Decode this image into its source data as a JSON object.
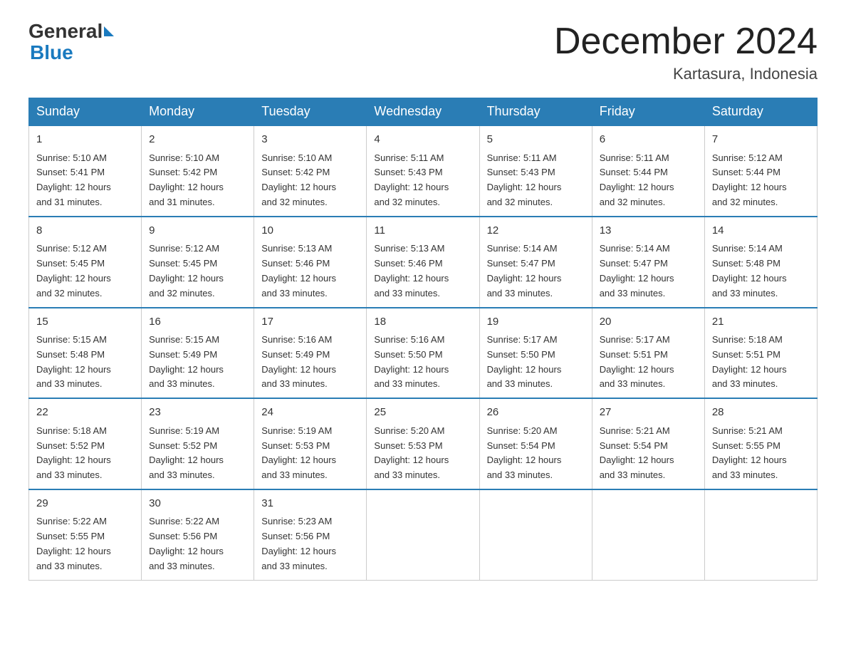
{
  "header": {
    "logo_general": "General",
    "logo_blue": "Blue",
    "title": "December 2024",
    "location": "Kartasura, Indonesia"
  },
  "days_of_week": [
    "Sunday",
    "Monday",
    "Tuesday",
    "Wednesday",
    "Thursday",
    "Friday",
    "Saturday"
  ],
  "weeks": [
    [
      {
        "day": "1",
        "sunrise": "5:10 AM",
        "sunset": "5:41 PM",
        "daylight": "12 hours and 31 minutes."
      },
      {
        "day": "2",
        "sunrise": "5:10 AM",
        "sunset": "5:42 PM",
        "daylight": "12 hours and 31 minutes."
      },
      {
        "day": "3",
        "sunrise": "5:10 AM",
        "sunset": "5:42 PM",
        "daylight": "12 hours and 32 minutes."
      },
      {
        "day": "4",
        "sunrise": "5:11 AM",
        "sunset": "5:43 PM",
        "daylight": "12 hours and 32 minutes."
      },
      {
        "day": "5",
        "sunrise": "5:11 AM",
        "sunset": "5:43 PM",
        "daylight": "12 hours and 32 minutes."
      },
      {
        "day": "6",
        "sunrise": "5:11 AM",
        "sunset": "5:44 PM",
        "daylight": "12 hours and 32 minutes."
      },
      {
        "day": "7",
        "sunrise": "5:12 AM",
        "sunset": "5:44 PM",
        "daylight": "12 hours and 32 minutes."
      }
    ],
    [
      {
        "day": "8",
        "sunrise": "5:12 AM",
        "sunset": "5:45 PM",
        "daylight": "12 hours and 32 minutes."
      },
      {
        "day": "9",
        "sunrise": "5:12 AM",
        "sunset": "5:45 PM",
        "daylight": "12 hours and 32 minutes."
      },
      {
        "day": "10",
        "sunrise": "5:13 AM",
        "sunset": "5:46 PM",
        "daylight": "12 hours and 33 minutes."
      },
      {
        "day": "11",
        "sunrise": "5:13 AM",
        "sunset": "5:46 PM",
        "daylight": "12 hours and 33 minutes."
      },
      {
        "day": "12",
        "sunrise": "5:14 AM",
        "sunset": "5:47 PM",
        "daylight": "12 hours and 33 minutes."
      },
      {
        "day": "13",
        "sunrise": "5:14 AM",
        "sunset": "5:47 PM",
        "daylight": "12 hours and 33 minutes."
      },
      {
        "day": "14",
        "sunrise": "5:14 AM",
        "sunset": "5:48 PM",
        "daylight": "12 hours and 33 minutes."
      }
    ],
    [
      {
        "day": "15",
        "sunrise": "5:15 AM",
        "sunset": "5:48 PM",
        "daylight": "12 hours and 33 minutes."
      },
      {
        "day": "16",
        "sunrise": "5:15 AM",
        "sunset": "5:49 PM",
        "daylight": "12 hours and 33 minutes."
      },
      {
        "day": "17",
        "sunrise": "5:16 AM",
        "sunset": "5:49 PM",
        "daylight": "12 hours and 33 minutes."
      },
      {
        "day": "18",
        "sunrise": "5:16 AM",
        "sunset": "5:50 PM",
        "daylight": "12 hours and 33 minutes."
      },
      {
        "day": "19",
        "sunrise": "5:17 AM",
        "sunset": "5:50 PM",
        "daylight": "12 hours and 33 minutes."
      },
      {
        "day": "20",
        "sunrise": "5:17 AM",
        "sunset": "5:51 PM",
        "daylight": "12 hours and 33 minutes."
      },
      {
        "day": "21",
        "sunrise": "5:18 AM",
        "sunset": "5:51 PM",
        "daylight": "12 hours and 33 minutes."
      }
    ],
    [
      {
        "day": "22",
        "sunrise": "5:18 AM",
        "sunset": "5:52 PM",
        "daylight": "12 hours and 33 minutes."
      },
      {
        "day": "23",
        "sunrise": "5:19 AM",
        "sunset": "5:52 PM",
        "daylight": "12 hours and 33 minutes."
      },
      {
        "day": "24",
        "sunrise": "5:19 AM",
        "sunset": "5:53 PM",
        "daylight": "12 hours and 33 minutes."
      },
      {
        "day": "25",
        "sunrise": "5:20 AM",
        "sunset": "5:53 PM",
        "daylight": "12 hours and 33 minutes."
      },
      {
        "day": "26",
        "sunrise": "5:20 AM",
        "sunset": "5:54 PM",
        "daylight": "12 hours and 33 minutes."
      },
      {
        "day": "27",
        "sunrise": "5:21 AM",
        "sunset": "5:54 PM",
        "daylight": "12 hours and 33 minutes."
      },
      {
        "day": "28",
        "sunrise": "5:21 AM",
        "sunset": "5:55 PM",
        "daylight": "12 hours and 33 minutes."
      }
    ],
    [
      {
        "day": "29",
        "sunrise": "5:22 AM",
        "sunset": "5:55 PM",
        "daylight": "12 hours and 33 minutes."
      },
      {
        "day": "30",
        "sunrise": "5:22 AM",
        "sunset": "5:56 PM",
        "daylight": "12 hours and 33 minutes."
      },
      {
        "day": "31",
        "sunrise": "5:23 AM",
        "sunset": "5:56 PM",
        "daylight": "12 hours and 33 minutes."
      },
      null,
      null,
      null,
      null
    ]
  ]
}
